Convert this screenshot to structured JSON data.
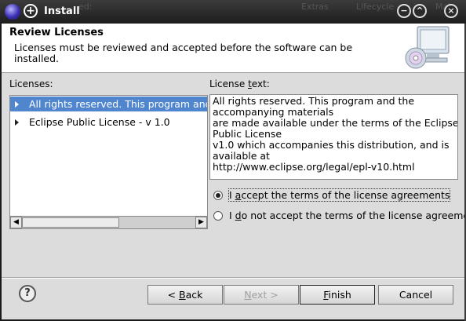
{
  "window": {
    "title": "Install",
    "bg_ghost_left": "ed:",
    "bg_ghost_extras": "Extras",
    "bg_ghost_lifecycle": "Lifecycle",
    "bg_ghost_mai": "Mai"
  },
  "header": {
    "title": "Review Licenses",
    "description": "Licenses must be reviewed and accepted before the software can be installed."
  },
  "licenses": {
    "label": "Licenses:",
    "items": [
      {
        "label": "All rights reserved. This program and the accompanying materials",
        "selected": true
      },
      {
        "label": "Eclipse Public License - v 1.0",
        "selected": false
      }
    ]
  },
  "license_text": {
    "label_prefix": "License ",
    "label_underlined": "t",
    "label_suffix": "ext:",
    "lines": [
      "All rights reserved. This program and the",
      "accompanying materials",
      "are made available under the terms of the Eclipse",
      "Public License",
      "v1.0 which accompanies this distribution, and is",
      "available at",
      "http://www.eclipse.org/legal/epl-v10.html"
    ]
  },
  "options": {
    "accept_prefix": "I ",
    "accept_mnemonic": "a",
    "accept_suffix": "ccept the terms of the license agreements",
    "decline_prefix": "I ",
    "decline_mnemonic": "d",
    "decline_suffix": "o not accept the terms of the license agreements",
    "selected": "accept"
  },
  "buttons": {
    "help": "?",
    "back_prefix": "< ",
    "back_mnemonic": "B",
    "back_suffix": "ack",
    "next_prefix": "",
    "next_mnemonic": "N",
    "next_suffix": "ext >",
    "finish_prefix": "",
    "finish_mnemonic": "F",
    "finish_suffix": "inish",
    "cancel": "Cancel"
  }
}
